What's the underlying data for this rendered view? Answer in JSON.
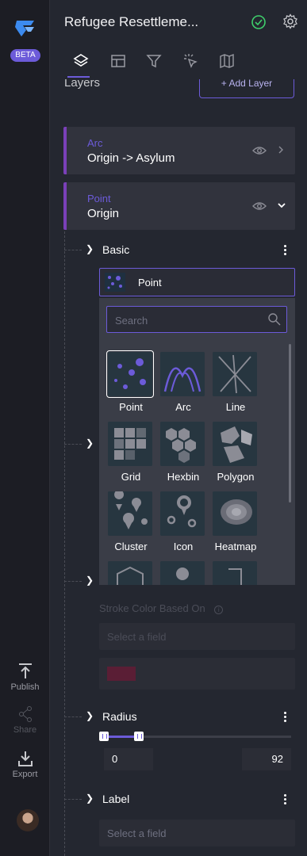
{
  "rail": {
    "beta": "BETA",
    "publish": "Publish",
    "share": "Share",
    "export": "Export"
  },
  "header": {
    "title": "Refugee Resettleme...",
    "tabs": [
      "layers-icon",
      "filter-table-icon",
      "filter-icon",
      "interactions-icon",
      "basemap-icon"
    ]
  },
  "layers_section": {
    "title": "Layers",
    "add_button": "+ Add Layer"
  },
  "layers": [
    {
      "type": "Arc",
      "name": "Origin -> Asylum",
      "expanded": false
    },
    {
      "type": "Point",
      "name": "Origin",
      "expanded": true
    }
  ],
  "point_layer": {
    "basic_label": "Basic",
    "selected_type": "Point",
    "search_placeholder": "Search",
    "layer_types": [
      "Point",
      "Arc",
      "Line",
      "Grid",
      "Hexbin",
      "Polygon",
      "Cluster",
      "Icon",
      "Heatmap"
    ],
    "stroke_color_based_on": "Stroke Color Based On",
    "stroke_select_placeholder": "Select a field",
    "radius_label": "Radius",
    "radius_min": "0",
    "radius_max": "92",
    "label_label": "Label",
    "label_select_placeholder": "Select a field"
  },
  "colors": {
    "accent": "#6c5bd9",
    "layer_bar": "#7a40b8",
    "ok_green": "#3fcf6b",
    "stroke_swatch": "#5a1e35"
  }
}
